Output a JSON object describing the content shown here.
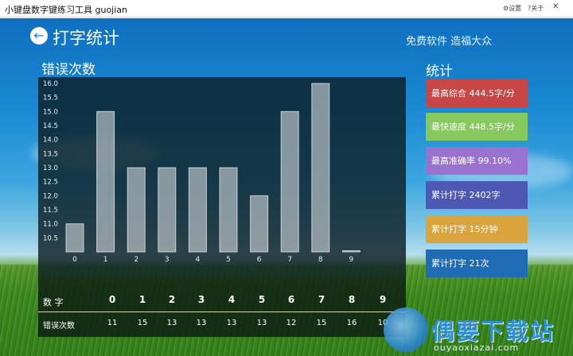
{
  "window": {
    "title": "小键盘数字键练习工具 guojian",
    "settings_label": "设置",
    "about_label": "关于"
  },
  "header": {
    "title": "打字统计",
    "slogan": "免费软件  造福大众"
  },
  "errors_section": {
    "title": "错误次数"
  },
  "chart_data": {
    "type": "bar",
    "categories": [
      "0",
      "1",
      "2",
      "3",
      "4",
      "5",
      "6",
      "7",
      "8",
      "9"
    ],
    "values": [
      11,
      15,
      13,
      13,
      13,
      13,
      12,
      15,
      16,
      10
    ],
    "title": "",
    "xlabel": "",
    "ylabel": "",
    "ylim": [
      10,
      16
    ],
    "yticks": [
      "10.5",
      "11.0",
      "11.5",
      "12.0",
      "12.5",
      "13.0",
      "13.5",
      "14.0",
      "14.5",
      "15.0",
      "15.5",
      "16.0"
    ],
    "grid": false
  },
  "table": {
    "header_label": "数 字",
    "row_label": "错误次数",
    "digits": [
      "0",
      "1",
      "2",
      "3",
      "4",
      "5",
      "6",
      "7",
      "8",
      "9"
    ],
    "counts": [
      "11",
      "15",
      "13",
      "13",
      "13",
      "13",
      "12",
      "15",
      "16",
      "10"
    ]
  },
  "stats": {
    "title": "统计",
    "items": [
      {
        "label": "最高综合 444.5字/分",
        "color": "#c84646"
      },
      {
        "label": "最快速度 448.5字/分",
        "color": "#86c95e"
      },
      {
        "label": "最高准确率 99.10%",
        "color": "#9a72cf"
      },
      {
        "label": "累计打字 2402字",
        "color": "#4d58b5"
      },
      {
        "label": "累计打字 15分钟",
        "color": "#d9a43e"
      },
      {
        "label": "累计打字 21次",
        "color": "#1f6cb5"
      }
    ]
  },
  "watermark": {
    "text": "偶要下载站",
    "sub": "ouyaoxiazai.com"
  }
}
